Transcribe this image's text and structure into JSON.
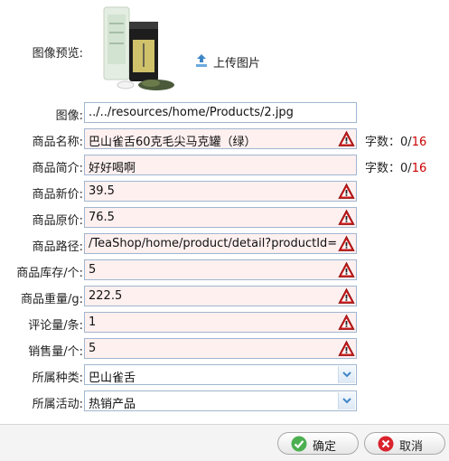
{
  "preview": {
    "label": "图像预览:",
    "upload_label": "上传图片"
  },
  "form": {
    "image": {
      "label": "图像:",
      "value": "../../resources/home/Products/2.jpg"
    },
    "name": {
      "label": "商品名称:",
      "value": "巴山雀舌60克毛尖马克罐（绿）",
      "counter_prefix": "字数：",
      "count": "0",
      "max": "16"
    },
    "intro": {
      "label": "商品简介:",
      "value": "好好喝啊",
      "counter_prefix": "字数：",
      "count": "0",
      "max": "16"
    },
    "new_price": {
      "label": "商品新价:",
      "value": "39.5"
    },
    "old_price": {
      "label": "商品原价:",
      "value": "76.5"
    },
    "path": {
      "label": "商品路径:",
      "value": "/TeaShop/home/product/detail?productId="
    },
    "stock": {
      "label": "商品库存/个:",
      "value": "5"
    },
    "weight": {
      "label": "商品重量/g:",
      "value": "222.5"
    },
    "reviews": {
      "label": "评论量/条:",
      "value": "1"
    },
    "sales": {
      "label": "销售量/个:",
      "value": "5"
    },
    "category": {
      "label": "所属种类:",
      "value": "巴山雀舌"
    },
    "activity": {
      "label": "所属活动:",
      "value": "热销产品"
    }
  },
  "buttons": {
    "confirm": "确定",
    "cancel": "取消"
  },
  "colors": {
    "invalid_bg": "#fff0f0",
    "border": "#9fb6cf",
    "warn_red": "#cc1a1a",
    "counter_max": "#cc0000"
  },
  "icons": {
    "warning": "warning-icon",
    "upload": "upload-icon",
    "dropdown": "chevron-down-icon",
    "confirm": "check-icon",
    "cancel": "cancel-icon"
  }
}
